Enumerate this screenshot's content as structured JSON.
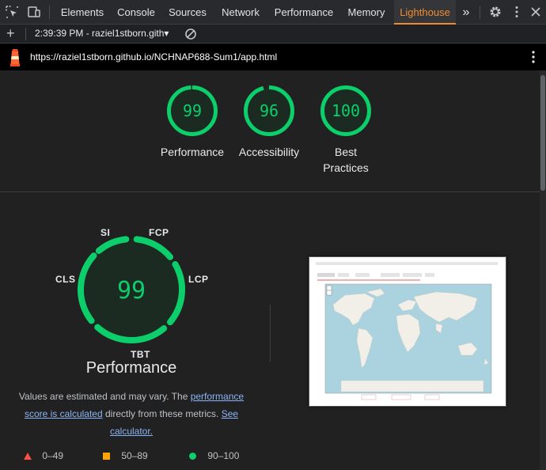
{
  "devtools": {
    "tabs": [
      {
        "label": "Elements"
      },
      {
        "label": "Console"
      },
      {
        "label": "Sources"
      },
      {
        "label": "Network"
      },
      {
        "label": "Performance"
      },
      {
        "label": "Memory"
      },
      {
        "label": "Lighthouse",
        "active": true
      }
    ],
    "more_tabs_glyph": "»",
    "accent_color": "#f28b30"
  },
  "toolbar": {
    "report_selector": "2:39:39 PM - raziel1stborn.gith",
    "dropdown_glyph": "▾",
    "add_glyph": "+"
  },
  "url": "https://raziel1stborn.github.io/NCHNAP688-Sum1/app.html",
  "summary_scores": [
    {
      "score": "99",
      "label": "Performance",
      "fraction": 0.99
    },
    {
      "score": "96",
      "label": "Accessibility",
      "fraction": 0.96
    },
    {
      "score": "100",
      "label_line1": "Best",
      "label_line2": "Practices",
      "fraction": 1.0
    }
  ],
  "performance_detail": {
    "score": "99",
    "title": "Performance",
    "metric_labels": {
      "si": "SI",
      "fcp": "FCP",
      "lcp": "LCP",
      "tbt": "TBT",
      "cls": "CLS"
    },
    "note_prefix": "Values are estimated and may vary. The ",
    "note_link1": "performance score is calculated",
    "note_middle": " directly from these metrics. ",
    "note_link2": "See calculator."
  },
  "legend": [
    {
      "shape": "triangle",
      "range": "0–49",
      "color": "#ff4e42"
    },
    {
      "shape": "square",
      "range": "50–89",
      "color": "#ffa400"
    },
    {
      "shape": "circle",
      "range": "90–100",
      "color": "#0cce6b"
    }
  ],
  "score_color": "#0cce6b"
}
